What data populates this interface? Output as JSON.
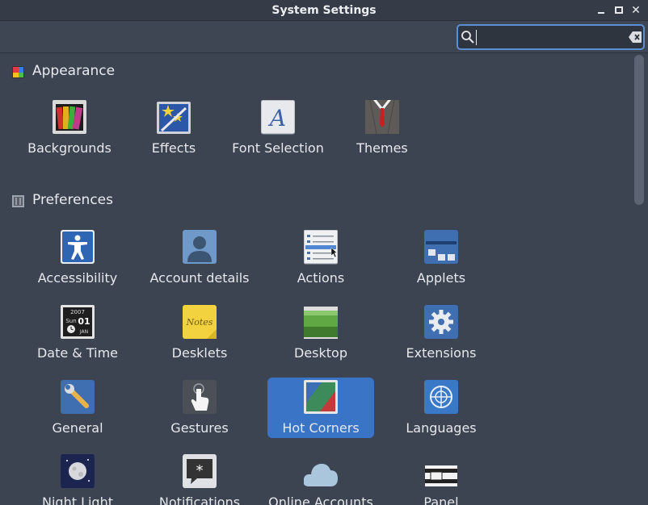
{
  "window": {
    "title": "System Settings"
  },
  "search": {
    "value": "",
    "placeholder": ""
  },
  "sections": [
    {
      "title": "Appearance",
      "items": [
        "Backgrounds",
        "Effects",
        "Font Selection",
        "Themes"
      ]
    },
    {
      "title": "Preferences",
      "items": [
        "Accessibility",
        "Account details",
        "Actions",
        "Applets",
        "Date & Time",
        "Desklets",
        "Desktop",
        "Extensions",
        "General",
        "Gestures",
        "Hot Corners",
        "Languages",
        "Night Light",
        "Notifications",
        "Online Accounts",
        "Panel"
      ]
    }
  ],
  "icon_texts": {
    "calendar_year": "2007",
    "calendar_day": "Sun",
    "calendar_date": "01",
    "calendar_month": "JAN",
    "notes": "Notes",
    "font_letter": "A"
  },
  "selected_item": "Hot Corners",
  "colors": {
    "selection": "#3a74c6",
    "search_border": "#5b8fd4",
    "background": "#3c4452"
  }
}
